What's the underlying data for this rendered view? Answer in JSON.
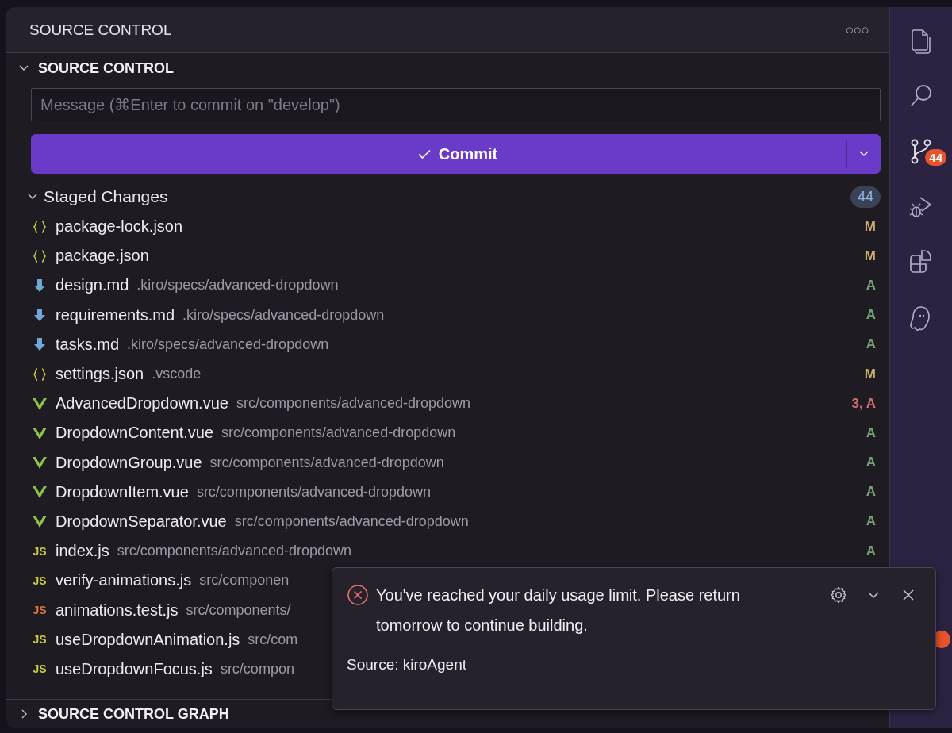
{
  "panel": {
    "title": "SOURCE CONTROL",
    "more": "○○○"
  },
  "section": {
    "title": "SOURCE CONTROL",
    "expanded": true
  },
  "message": {
    "placeholder": "Message (⌘Enter to commit on \"develop\")"
  },
  "commit": {
    "label": "Commit"
  },
  "staged": {
    "title": "Staged Changes",
    "expanded": true,
    "count": "44"
  },
  "files": [
    {
      "kind": "json",
      "name": "package-lock.json",
      "status": {
        "text": "M",
        "color": "#c8ad6e"
      }
    },
    {
      "kind": "json",
      "name": "package.json",
      "status": {
        "text": "M",
        "color": "#c8ad6e"
      }
    },
    {
      "kind": "md",
      "name": "design.md",
      "path": ".kiro/specs/advanced-dropdown",
      "status": {
        "text": "A",
        "color": "#74a274"
      }
    },
    {
      "kind": "md",
      "name": "requirements.md",
      "path": ".kiro/specs/advanced-dropdown",
      "status": {
        "text": "A",
        "color": "#74a274"
      }
    },
    {
      "kind": "md",
      "name": "tasks.md",
      "path": ".kiro/specs/advanced-dropdown",
      "status": {
        "text": "A",
        "color": "#74a274"
      }
    },
    {
      "kind": "json",
      "name": "settings.json",
      "path": ".vscode",
      "status": {
        "text": "M",
        "color": "#c8ad6e"
      }
    },
    {
      "kind": "vue",
      "name": "AdvancedDropdown.vue",
      "path": "src/components/advanced-dropdown",
      "status": {
        "text": "3, A",
        "color": "#d36c6c"
      }
    },
    {
      "kind": "vue",
      "name": "DropdownContent.vue",
      "path": "src/components/advanced-dropdown",
      "status": {
        "text": "A",
        "color": "#74a274"
      }
    },
    {
      "kind": "vue",
      "name": "DropdownGroup.vue",
      "path": "src/components/advanced-dropdown",
      "status": {
        "text": "A",
        "color": "#74a274"
      }
    },
    {
      "kind": "vue",
      "name": "DropdownItem.vue",
      "path": "src/components/advanced-dropdown",
      "status": {
        "text": "A",
        "color": "#74a274"
      }
    },
    {
      "kind": "vue",
      "name": "DropdownSeparator.vue",
      "path": "src/components/advanced-dropdown",
      "status": {
        "text": "A",
        "color": "#74a274"
      }
    },
    {
      "kind": "js",
      "icon_label": "JS",
      "name": "index.js",
      "path": "src/components/advanced-dropdown",
      "status": {
        "text": "A",
        "color": "#74a274"
      }
    },
    {
      "kind": "js",
      "icon_label": "JS",
      "name": "verify-animations.js",
      "path": "src/componen"
    },
    {
      "kind": "test",
      "icon_label": "JS",
      "name": "animations.test.js",
      "path": "src/components/"
    },
    {
      "kind": "js",
      "icon_label": "JS",
      "name": "useDropdownAnimation.js",
      "path": "src/com"
    },
    {
      "kind": "js",
      "icon_label": "JS",
      "name": "useDropdownFocus.js",
      "path": "src/compon"
    }
  ],
  "graph": {
    "title": "SOURCE CONTROL GRAPH",
    "expanded": false
  },
  "activity_bar": [
    {
      "kind": "files",
      "selected": false
    },
    {
      "kind": "search",
      "selected": false
    },
    {
      "kind": "source-control",
      "selected": true,
      "badge": "44"
    },
    {
      "kind": "run-debug",
      "selected": false
    },
    {
      "kind": "extensions",
      "selected": false
    },
    {
      "kind": "ghost",
      "selected": false
    }
  ],
  "notification": {
    "message": "You've reached your daily usage limit. Please return tomorrow to continue building.",
    "source": "Source: kiroAgent"
  }
}
